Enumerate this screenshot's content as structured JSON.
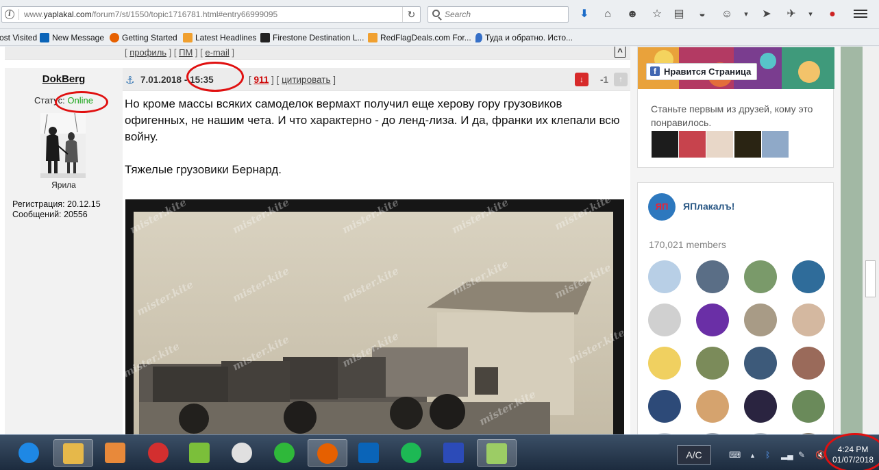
{
  "browser": {
    "url_prefix": "www.",
    "url_domain": "yaplakal.com",
    "url_path": "/forum7/st/1550/topic1716781.html#entry66999095",
    "search_placeholder": "Search",
    "bookmarks": [
      {
        "label": "ost Visited",
        "icon": "gear-icon",
        "color": "#7a8a9a"
      },
      {
        "label": "New Message",
        "icon": "outlook-icon",
        "color": "#0a64b8"
      },
      {
        "label": "Getting Started",
        "icon": "firefox-icon",
        "color": "#e66000"
      },
      {
        "label": "Latest Headlines",
        "icon": "rss-icon",
        "color": "#f0a030"
      },
      {
        "label": "Firestone Destination L...",
        "icon": "firestone-icon",
        "color": "#222222"
      },
      {
        "label": "RedFlagDeals.com For...",
        "icon": "rss-icon",
        "color": "#f0a030"
      },
      {
        "label": "Туда и обратно. Исто...",
        "icon": "pin-icon",
        "color": "#3670c8"
      }
    ]
  },
  "forum": {
    "prev_links": {
      "profile": "профиль",
      "pm": "ПМ",
      "email": "e-mail",
      "to_top": "^"
    },
    "author": {
      "nick": "DokBerg",
      "status_label": "Статус:",
      "status_value": "Online",
      "title": "Ярила",
      "registration": "Регистрация: 20.12.15",
      "posts": "Сообщений: 20556"
    },
    "post": {
      "date": "7.01.2018",
      "time": "- 15:35",
      "number": "911",
      "quote": "цитировать",
      "rating": "-1",
      "paragraphs": [
        "Но кроме массы всяких самоделок вермахт получил еще херову гору грузовиков офигенных, не нашим чета. И что характерно - до ленд-лиза. И да, франки их клепали всю войну.",
        "Тяжелые грузовики Бернард."
      ],
      "watermark": "mister.kite"
    }
  },
  "sidebar": {
    "fb": {
      "like_label": "Нравится Страница",
      "text": "Станьте первым из друзей, кому это понравилось."
    },
    "vk": {
      "logo": "ЯП",
      "name": "ЯПлакалъ!",
      "members": "170,021 members"
    }
  },
  "taskbar": {
    "ac_label": "A/C",
    "time": "4:24 PM",
    "date": "01/07/2018"
  }
}
